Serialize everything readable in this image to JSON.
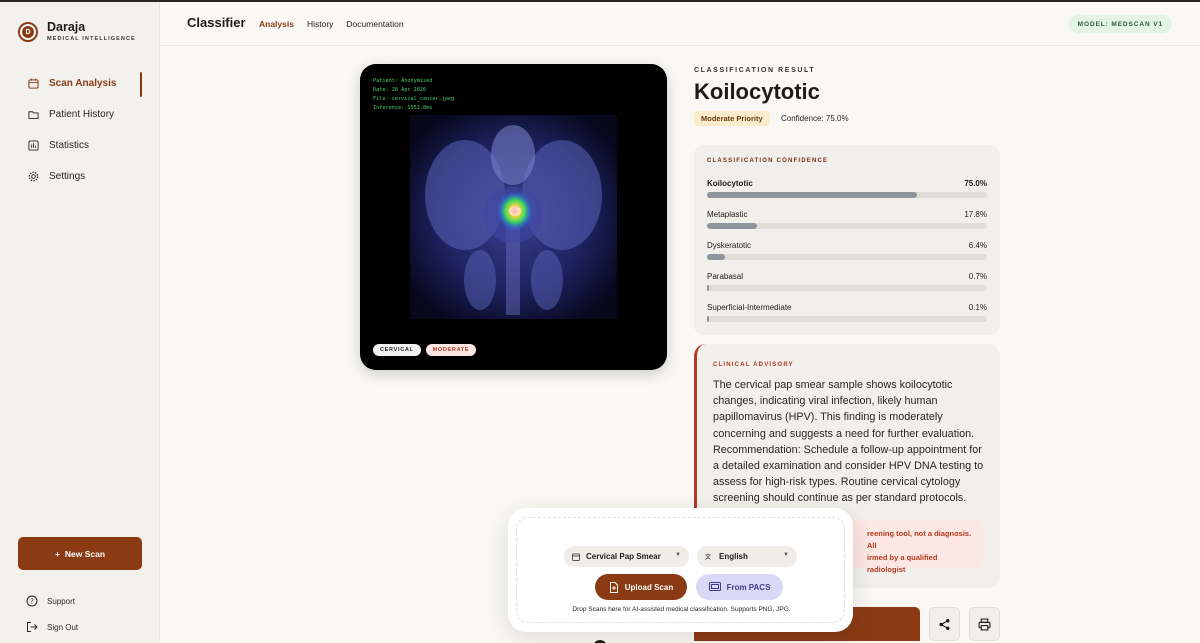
{
  "brand": {
    "name": "Daraja",
    "subtitle": "MEDICAL INTELLIGENCE",
    "logo_letter": "D"
  },
  "sidebar": {
    "items": [
      {
        "label": "Scan Analysis",
        "icon": "scan-icon",
        "active": true
      },
      {
        "label": "Patient History",
        "icon": "folder-icon",
        "active": false
      },
      {
        "label": "Statistics",
        "icon": "chart-icon",
        "active": false
      },
      {
        "label": "Settings",
        "icon": "gear-icon",
        "active": false
      }
    ],
    "new_scan_label": "New Scan",
    "support_label": "Support",
    "sign_out_label": "Sign Out"
  },
  "header": {
    "title": "Classifier",
    "tabs": [
      {
        "label": "Analysis",
        "active": true
      },
      {
        "label": "History",
        "active": false
      },
      {
        "label": "Documentation",
        "active": false
      }
    ],
    "model_badge": "MODEL: MEDSCAN V1"
  },
  "scan": {
    "meta": {
      "patient": "Patient: Anonymised",
      "date": "Date: 28 Apr 2026",
      "file": "File: cervical_cancer.jpeg",
      "inference": "Inference: 1552.8ms"
    },
    "tags": [
      "CERVICAL",
      "MODERATE"
    ]
  },
  "result": {
    "eyebrow": "CLASSIFICATION RESULT",
    "title": "Koilocytotic",
    "priority": "Moderate Priority",
    "confidence_text": "Confidence: 75.0%"
  },
  "confidence": {
    "eyebrow": "CLASSIFICATION CONFIDENCE",
    "rows": [
      {
        "label": "Koilocytotic",
        "value": "75.0%",
        "fraction": 0.75
      },
      {
        "label": "Metaplastic",
        "value": "17.8%",
        "fraction": 0.178
      },
      {
        "label": "Dyskeratotic",
        "value": "6.4%",
        "fraction": 0.064
      },
      {
        "label": "Parabasal",
        "value": "0.7%",
        "fraction": 0.007
      },
      {
        "label": "Superficial-Intermediate",
        "value": "0.1%",
        "fraction": 0.001
      }
    ]
  },
  "advisory": {
    "eyebrow": "CLINICAL ADVISORY",
    "body": "The cervical pap smear sample shows koilocytotic changes, indicating viral infection, likely human papillomavirus (HPV). This finding is moderately concerning and suggests a need for further evaluation. Recommendation: Schedule a follow-up appointment for a detailed examination and consider HPV DNA testing to assess for high-risk types. Routine cervical cytology screening should continue as per standard protocols.",
    "note_line1": "reening tool, not a diagnosis. All",
    "note_line2": "irmed by a qualified radiologist"
  },
  "upload": {
    "scan_type": "Cervical Pap Smear",
    "language": "English",
    "upload_label": "Upload Scan",
    "pacs_label": "From PACS",
    "hint": "Drop Scans here for AI-assisted medical classification. Supports PNG, JPG."
  },
  "colors": {
    "accent": "#8a3b14",
    "danger": "#b4391f",
    "bar": "#8f959c"
  }
}
